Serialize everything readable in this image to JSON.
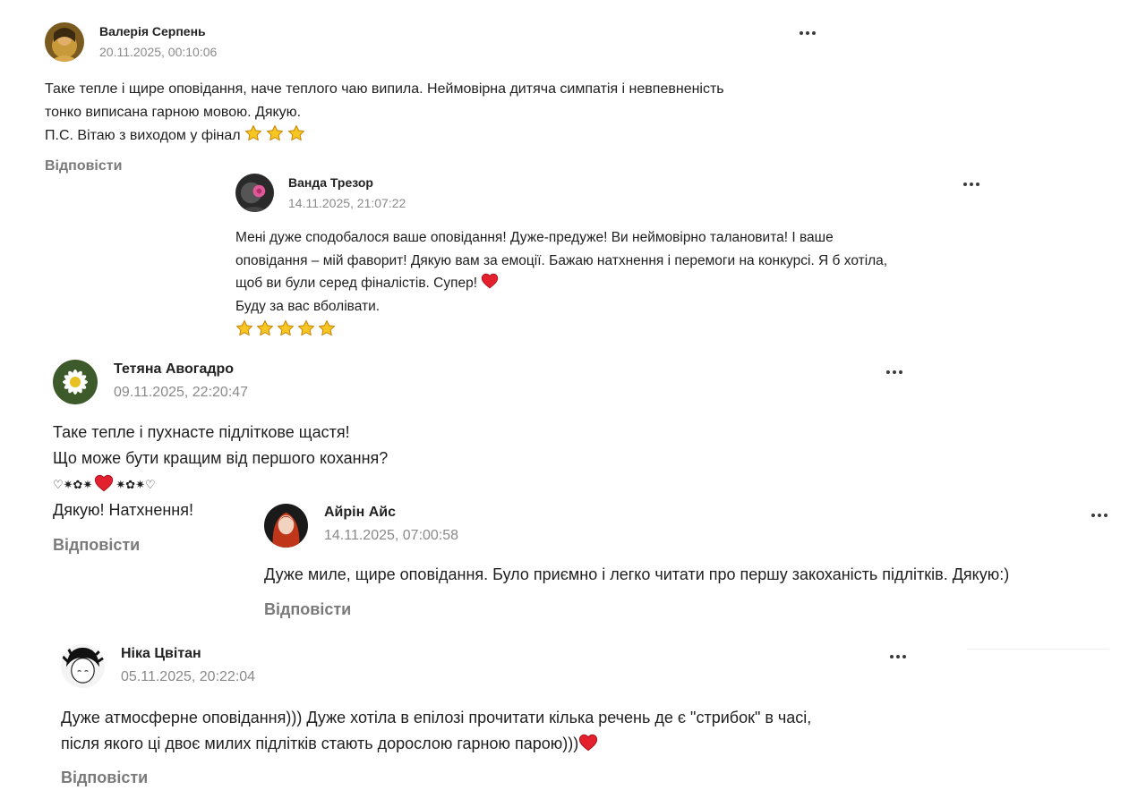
{
  "comments": [
    {
      "author": "Валерія Серпень",
      "date": "20.11.2025, 00:10:06",
      "lines": [
        "Таке тепле і щире оповідання, наче теплого чаю випила. Неймовірна дитяча симпатія і невпевненість",
        "тонко виписана гарною мовою. Дякую.",
        "П.С. Вітаю з виходом у фінал"
      ],
      "reply_label": "Відповісти"
    },
    {
      "author": "Ванда Трезор",
      "date": "14.11.2025, 21:07:22",
      "lines": [
        "Мені дуже сподобалося ваше оповідання! Дуже-предуже! Ви неймовірно талановита! І ваше",
        "оповідання – мій фаворит! Дякую вам за емоції. Бажаю натхнення і перемоги на конкурсі. Я б хотіла,",
        "щоб ви були серед фіналістів. Супер!",
        "Буду за вас вболівати."
      ]
    },
    {
      "author": "Тетяна Авогадро",
      "date": "09.11.2025, 22:20:47",
      "lines": [
        "Таке тепле і пухнасте підліткове щастя!",
        "Що може бути кращим від першого кохання?",
        "♡✷✿✷",
        "✷✿✷♡",
        "Дякую! Натхнення!"
      ],
      "reply_label": "Відповісти"
    },
    {
      "author": "Айрін Айс",
      "date": "14.11.2025, 07:00:58",
      "lines": [
        "Дуже миле, щире оповідання. Було приємно і легко читати про першу закоханість підлітків. Дякую:)"
      ],
      "reply_label": "Відповісти"
    },
    {
      "author": "Ніка Цвітан",
      "date": "05.11.2025, 20:22:04",
      "lines": [
        "Дуже атмосферне оповідання))) Дуже хотіла в епілозі прочитати кілька речень де є \"стрибок\" в часі,",
        "після якого ці двоє милих підлітків стають дорослою гарною парою)))"
      ],
      "reply_label": "Відповісти"
    }
  ],
  "colors": {
    "text": "#1f1f1f",
    "date": "#8a8a8a",
    "reply": "#7a7a7a",
    "star": "#f5c518",
    "heart": "#e0202c"
  },
  "icons": [
    "more-icon",
    "star-icon",
    "heart-icon"
  ]
}
